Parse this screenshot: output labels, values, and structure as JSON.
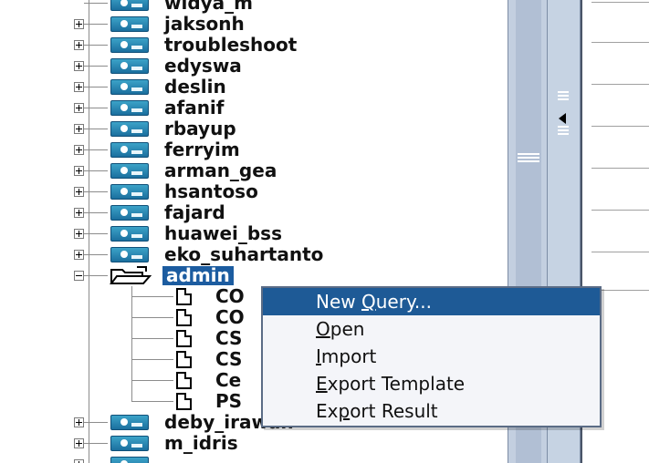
{
  "tree": {
    "users_top": [
      {
        "name": "widya_m",
        "expander": "none"
      },
      {
        "name": "jaksonh",
        "expander": "plus"
      },
      {
        "name": "troubleshoot",
        "expander": "plus"
      },
      {
        "name": "edyswa",
        "expander": "plus"
      },
      {
        "name": "deslin",
        "expander": "plus"
      },
      {
        "name": "afanif",
        "expander": "plus"
      },
      {
        "name": "rbayup",
        "expander": "plus"
      },
      {
        "name": "ferryim",
        "expander": "plus"
      },
      {
        "name": "arman_gea",
        "expander": "plus"
      },
      {
        "name": "hsantoso",
        "expander": "plus"
      },
      {
        "name": "fajard",
        "expander": "plus"
      },
      {
        "name": "huawei_bss",
        "expander": "plus"
      },
      {
        "name": "eko_suhartanto",
        "expander": "plus"
      }
    ],
    "selected_user": {
      "name": "admin",
      "expander": "minus"
    },
    "admin_children": [
      "CO",
      "CO",
      "CS",
      "CS",
      "Ce",
      "PS"
    ],
    "users_bottom": [
      {
        "name": "deby_irawan",
        "expander": "plus"
      },
      {
        "name": "m_idris",
        "expander": "plus"
      }
    ]
  },
  "context_menu": {
    "items": [
      {
        "pre": "New ",
        "mn": "Q",
        "post": "uery...",
        "highlighted": true
      },
      {
        "pre": "",
        "mn": "O",
        "post": "pen",
        "highlighted": false
      },
      {
        "pre": "",
        "mn": "I",
        "post": "mport",
        "highlighted": false
      },
      {
        "pre": "",
        "mn": "E",
        "post": "xport Template",
        "highlighted": false
      },
      {
        "pre": "Ex",
        "mn": "p",
        "post": "ort Result",
        "highlighted": false
      }
    ]
  },
  "colors": {
    "selection": "#1c5ca0",
    "menu_highlight": "#1e5a96",
    "user_icon": "#2a88b4",
    "scrollbar": "#c3cfe0"
  }
}
